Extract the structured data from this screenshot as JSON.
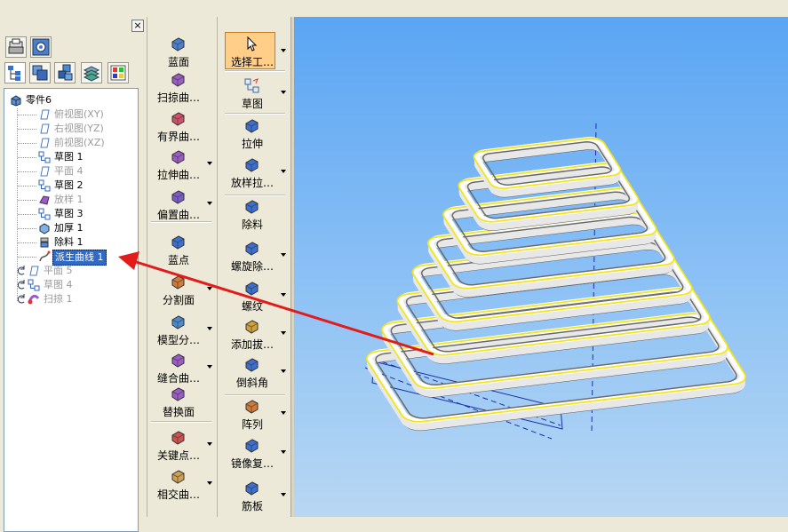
{
  "left_panel": {
    "close_glyph": "×",
    "top_icons": [
      "printer-icon",
      "settings-icon"
    ],
    "tab_icons": [
      "feature-tree-icon",
      "parts-icon",
      "assembly-icon",
      "layers-icon",
      "palette-icon"
    ],
    "tree": [
      {
        "label": "零件6",
        "icon": "part-icon",
        "state": "normal"
      },
      {
        "label": "俯视图(XY)",
        "icon": "plane-icon",
        "state": "grey"
      },
      {
        "label": "右视图(YZ)",
        "icon": "plane-icon",
        "state": "grey"
      },
      {
        "label": "前视图(XZ)",
        "icon": "plane-icon",
        "state": "grey"
      },
      {
        "label": "草图 1",
        "icon": "sketch-icon",
        "state": "normal"
      },
      {
        "label": "平面 4",
        "icon": "plane-icon",
        "state": "grey"
      },
      {
        "label": "草图 2",
        "icon": "sketch-icon",
        "state": "normal"
      },
      {
        "label": "放样 1",
        "icon": "loft-icon",
        "state": "grey"
      },
      {
        "label": "草图 3",
        "icon": "sketch-icon",
        "state": "normal"
      },
      {
        "label": "加厚 1",
        "icon": "thicken-icon",
        "state": "normal"
      },
      {
        "label": "除料 1",
        "icon": "cut-icon",
        "state": "normal"
      },
      {
        "label": "派生曲线 1",
        "icon": "derived-curve-icon",
        "state": "selected"
      },
      {
        "label": "平面 5",
        "icon": "plane-icon",
        "state": "grey"
      },
      {
        "label": "草图 4",
        "icon": "sketch-icon",
        "state": "grey"
      },
      {
        "label": "扫掠 1",
        "icon": "sweep-icon",
        "state": "grey"
      }
    ]
  },
  "surface_toolbar": [
    {
      "label": "蓝面",
      "icon": "blue-surface-icon",
      "dropdown": false
    },
    {
      "label": "扫掠曲…",
      "icon": "swept-surface-icon",
      "dropdown": false
    },
    {
      "label": "有界曲…",
      "icon": "bounded-surface-icon",
      "dropdown": false
    },
    {
      "label": "拉伸曲…",
      "icon": "extruded-surface-icon",
      "dropdown": true
    },
    {
      "label": "偏置曲…",
      "icon": "offset-surface-icon",
      "dropdown": true
    },
    {
      "label": "蓝点",
      "icon": "blue-dot-icon",
      "dropdown": false
    },
    {
      "label": "分割面",
      "icon": "split-face-icon",
      "dropdown": true
    },
    {
      "label": "模型分…",
      "icon": "model-split-icon",
      "dropdown": true
    },
    {
      "label": "缝合曲…",
      "icon": "stitch-surface-icon",
      "dropdown": true
    },
    {
      "label": "替换面",
      "icon": "replace-face-icon",
      "dropdown": false
    },
    {
      "label": "关键点…",
      "icon": "keypoint-icon",
      "dropdown": true
    },
    {
      "label": "相交曲…",
      "icon": "intersection-curve-icon",
      "dropdown": true
    }
  ],
  "feature_toolbar": [
    {
      "label": "选择工…",
      "icon": "select-cursor-icon",
      "dropdown": true
    },
    {
      "label": "草图",
      "icon": "sketch-tool-icon",
      "dropdown": true
    },
    {
      "label": "拉伸",
      "icon": "extrude-icon",
      "dropdown": false
    },
    {
      "label": "放样拉…",
      "icon": "loft-protrusion-icon",
      "dropdown": true
    },
    {
      "label": "除料",
      "icon": "cutout-icon",
      "dropdown": false
    },
    {
      "label": "螺旋除…",
      "icon": "helix-cutout-icon",
      "dropdown": true
    },
    {
      "label": "螺纹",
      "icon": "thread-icon",
      "dropdown": true
    },
    {
      "label": "添加拔…",
      "icon": "draft-icon",
      "dropdown": true
    },
    {
      "label": "倒斜角",
      "icon": "chamfer-icon",
      "dropdown": true
    },
    {
      "label": "阵列",
      "icon": "pattern-icon",
      "dropdown": true
    },
    {
      "label": "镜像复…",
      "icon": "mirror-icon",
      "dropdown": true
    },
    {
      "label": "筋板",
      "icon": "rib-icon",
      "dropdown": true
    }
  ]
}
